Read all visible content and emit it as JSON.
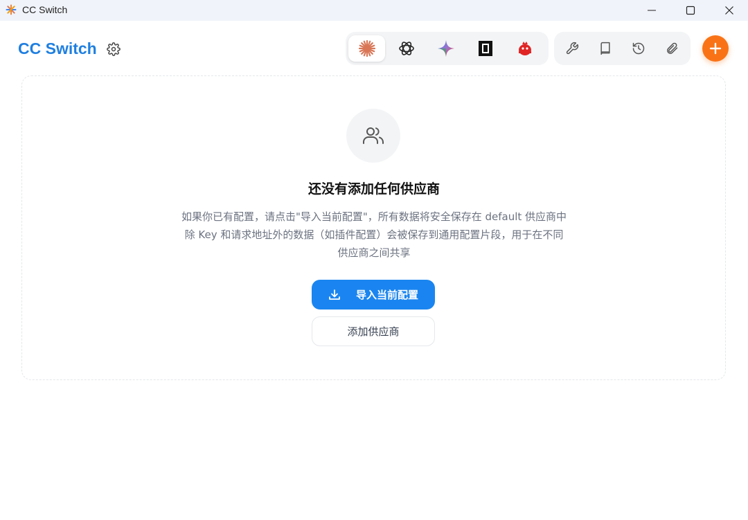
{
  "window": {
    "title": "CC Switch"
  },
  "header": {
    "brand": "CC Switch"
  },
  "apps": [
    {
      "name": "claude",
      "icon": "claude-sparkle-icon",
      "active": true
    },
    {
      "name": "openai",
      "icon": "openai-icon",
      "active": false
    },
    {
      "name": "gemini",
      "icon": "gemini-star-icon",
      "active": false
    },
    {
      "name": "opencode",
      "icon": "square-app-icon",
      "active": false
    },
    {
      "name": "mascot",
      "icon": "red-mascot-icon",
      "active": false
    }
  ],
  "tools": [
    "wrench-icon",
    "book-icon",
    "history-icon",
    "paperclip-icon"
  ],
  "empty_state": {
    "title": "还没有添加任何供应商",
    "description_line1": "如果你已有配置，请点击\"导入当前配置\"，所有数据将安全保存在 default 供应商中",
    "description_line2": "除 Key 和请求地址外的数据（如插件配置）会被保存到通用配置片段，用于在不同",
    "description_line3": "供应商之间共享",
    "import_label": "导入当前配置",
    "add_label": "添加供应商"
  },
  "colors": {
    "brand": "#1f7fe0",
    "primary": "#1a85f0",
    "accent": "#f97316"
  }
}
